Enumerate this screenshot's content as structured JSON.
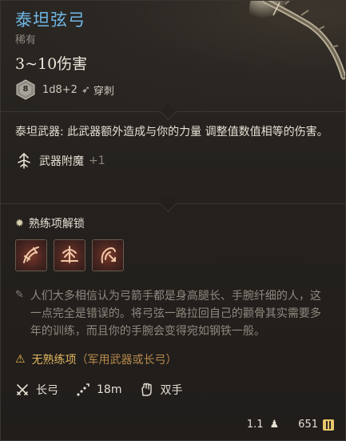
{
  "item": {
    "name": "泰坦弦弓",
    "rarity": "稀有",
    "damage_range": "3~10伤害",
    "dice_label": "8",
    "dice_formula": "1d8+2",
    "damage_type": "穿刺"
  },
  "description": {
    "text": "泰坦武器: 此武器额外造成与你的力量 调整值数值相等的伤害。"
  },
  "enchant": {
    "label": "武器附魔",
    "value": "+1"
  },
  "proficiency": {
    "title": "熟练项解锁",
    "icons": [
      "piercing-shot-icon",
      "brace-icon",
      "mobile-shot-icon"
    ]
  },
  "lore": {
    "text": "人们大多相信认为弓箭手都是身高腿长、手腕纤细的人，这一点完全是错误的。将弓弦一路拉回自己的颧骨其实需要多年的训练，而且你的手腕会变得宛如钢铁一般。"
  },
  "warning": {
    "main": "无熟练项",
    "sub": "（军用武器或长弓）"
  },
  "properties": {
    "weapon_type": "长弓",
    "range": "18m",
    "handedness": "双手"
  },
  "footer": {
    "weight": "1.1",
    "value": "651"
  },
  "colors": {
    "title": "#6fb8e6",
    "warning": "#e1b55e",
    "coin": "#e8c66a"
  }
}
